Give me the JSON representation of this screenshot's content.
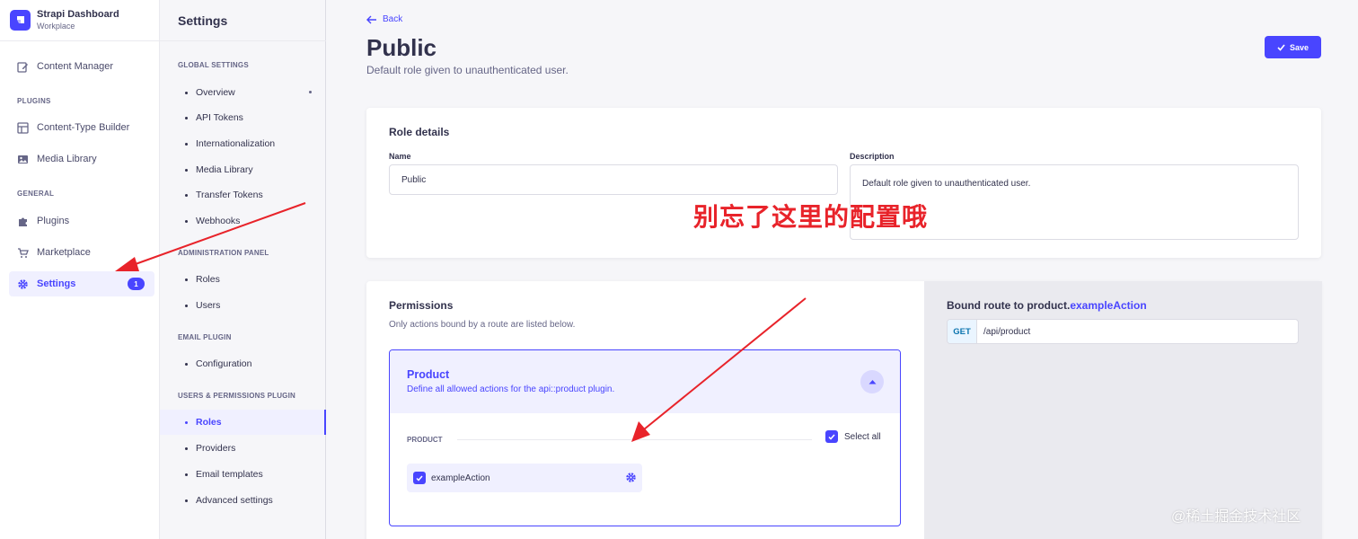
{
  "brand": {
    "title": "Strapi Dashboard",
    "subtitle": "Workplace"
  },
  "mainnav": {
    "content_manager": "Content Manager",
    "plugins_section": "PLUGINS",
    "content_type_builder": "Content-Type Builder",
    "media_library": "Media Library",
    "general_section": "GENERAL",
    "plugins": "Plugins",
    "marketplace": "Marketplace",
    "settings": "Settings",
    "settings_badge": "1"
  },
  "subnav": {
    "title": "Settings",
    "global_section": "GLOBAL SETTINGS",
    "global_items": [
      "Overview",
      "API Tokens",
      "Internationalization",
      "Media Library",
      "Transfer Tokens",
      "Webhooks"
    ],
    "admin_section": "ADMINISTRATION PANEL",
    "admin_items": [
      "Roles",
      "Users"
    ],
    "email_section": "EMAIL PLUGIN",
    "email_items": [
      "Configuration"
    ],
    "up_section": "USERS & PERMISSIONS PLUGIN",
    "up_items": [
      "Roles",
      "Providers",
      "Email templates",
      "Advanced settings"
    ]
  },
  "header": {
    "back": "Back",
    "title": "Public",
    "subtitle": "Default role given to unauthenticated user.",
    "save": "Save"
  },
  "role_details": {
    "heading": "Role details",
    "name_label": "Name",
    "name_value": "Public",
    "description_label": "Description",
    "description_value": "Default role given to unauthenticated user."
  },
  "permissions": {
    "heading": "Permissions",
    "subheading": "Only actions bound by a route are listed below.",
    "product_title": "Product",
    "product_desc": "Define all allowed actions for the api::product plugin.",
    "group_label": "PRODUCT",
    "select_all": "Select all",
    "action": "exampleAction"
  },
  "bound_route": {
    "heading_prefix": "Bound route to product.",
    "heading_action": "exampleAction",
    "method": "GET",
    "path": "/api/product"
  },
  "annotation": "别忘了这里的配置哦",
  "watermark": "@稀土掘金技术社区",
  "colors": {
    "primary": "#4945ff",
    "annotation": "#e8232a",
    "get_method": "#0c75af"
  }
}
